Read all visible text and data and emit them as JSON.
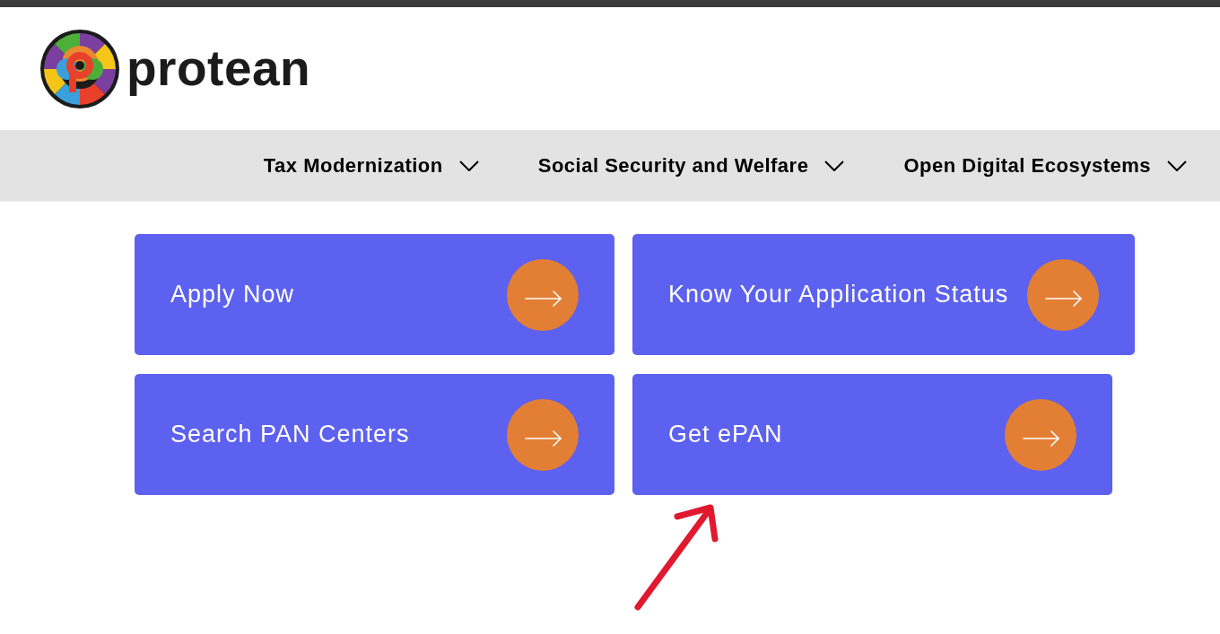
{
  "header": {
    "logo_text": "protean"
  },
  "nav": {
    "items": [
      {
        "label": "Tax Modernization"
      },
      {
        "label": "Social Security and Welfare"
      },
      {
        "label": "Open Digital Ecosystems"
      }
    ]
  },
  "cards": [
    {
      "label": "Apply Now"
    },
    {
      "label": "Know Your Application Status"
    },
    {
      "label": "Search PAN Centers"
    },
    {
      "label": "Get ePAN"
    }
  ]
}
